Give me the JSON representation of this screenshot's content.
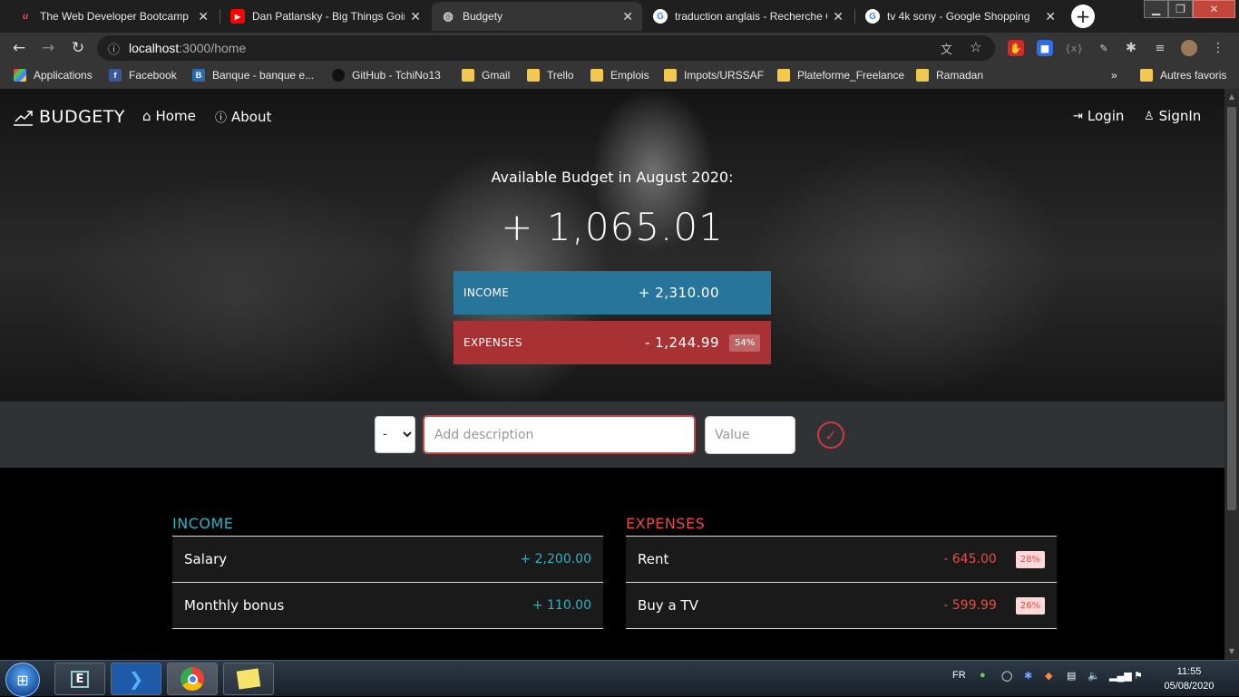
{
  "browser": {
    "tabs": [
      {
        "title": "The Web Developer Bootcamp |",
        "favicon": "udemy-icon",
        "color": "#ec5252"
      },
      {
        "title": "Dan Patlansky - Big Things Goin",
        "favicon": "youtube-icon",
        "color": "#ff0000"
      },
      {
        "title": "Budgety",
        "favicon": "globe-icon",
        "color": "#bbbbbb"
      },
      {
        "title": "traduction anglais - Recherche G",
        "favicon": "google-icon",
        "color": "#4285f4"
      },
      {
        "title": "tv 4k sony - Google Shopping",
        "favicon": "google-icon",
        "color": "#4285f4"
      }
    ],
    "address": {
      "host": "localhost",
      "path": ":3000/home"
    },
    "bookmarks": [
      {
        "label": "Applications"
      },
      {
        "label": "Facebook"
      },
      {
        "label": "Banque - banque e..."
      },
      {
        "label": "GitHub - TchiNo13"
      },
      {
        "label": "Gmail"
      },
      {
        "label": "Trello"
      },
      {
        "label": "Emplois"
      },
      {
        "label": "Impots/URSSAF"
      },
      {
        "label": "Plateforme_Freelance"
      },
      {
        "label": "Ramadan"
      },
      {
        "label": "Autres favoris"
      }
    ],
    "bookmarks_more": "»"
  },
  "nav": {
    "brand": "BUDGETY",
    "home": "Home",
    "about": "About",
    "login": "Login",
    "signin": "SignIn"
  },
  "budget": {
    "title": "Available Budget in August 2020:",
    "value": "+ 1,065.01",
    "income_label": "INCOME",
    "income_value": "+ 2,310.00",
    "expenses_label": "EXPENSES",
    "expenses_value": "- 1,244.99",
    "expenses_percentage": "54%",
    "income_color": "#28759c",
    "expenses_color": "#a83233"
  },
  "add": {
    "type_selected": "-",
    "description_placeholder": "Add description",
    "value_placeholder": "Value"
  },
  "income": {
    "title": "INCOME",
    "items": [
      {
        "description": "Salary",
        "value": "+ 2,200.00"
      },
      {
        "description": "Monthly bonus",
        "value": "+ 110.00"
      }
    ]
  },
  "expenses": {
    "title": "EXPENSES",
    "items": [
      {
        "description": "Rent",
        "value": "- 645.00",
        "percentage": "28%"
      },
      {
        "description": "Buy a TV",
        "value": "- 599.99",
        "percentage": "26%"
      }
    ]
  },
  "taskbar": {
    "language": "FR",
    "time": "11:55",
    "date": "05/08/2020"
  }
}
